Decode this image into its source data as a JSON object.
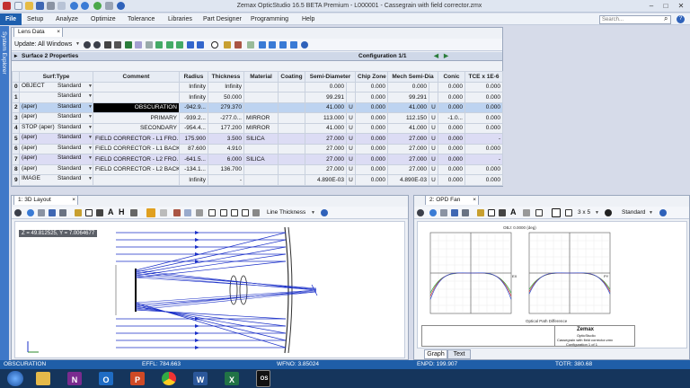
{
  "app": {
    "title": "Zemax OpticStudio 16.5  BETA  Premium - L000001 - Cassegrain with field corrector.zmx",
    "search_placeholder": "Search..."
  },
  "menu": {
    "file": "File",
    "items": [
      "Setup",
      "Analyze",
      "Optimize",
      "Tolerance",
      "Libraries",
      "Part Designer",
      "Programming",
      "Help"
    ]
  },
  "sidebar": {
    "label": "System Explorer"
  },
  "lens_data": {
    "tab": "Lens Data",
    "update_label": "Update: All Windows",
    "props_label": "Surface 2 Properties",
    "config_label": "Configuration 1/1",
    "columns": [
      "Surf:Type",
      "Comment",
      "Radius",
      "Thickness",
      "Material",
      "Coating",
      "Semi-Diameter",
      "Chip Zone",
      "Mech Semi-Dia",
      "Conic",
      "TCE x 1E-6"
    ],
    "rows": [
      {
        "n": "0",
        "name": "OBJECT",
        "type": "Standard",
        "comment": "",
        "radius": "Infinity",
        "thickness": "Infinity",
        "material": "",
        "coating": "",
        "semi": "0.000",
        "su": "",
        "chip": "0.000",
        "mech": "0.000",
        "conic": "0.000",
        "tce": "0.000"
      },
      {
        "n": "1",
        "name": "",
        "type": "Standard",
        "comment": "",
        "radius": "Infinity",
        "thickness": "50.000",
        "material": "",
        "coating": "",
        "semi": "99.291",
        "su": "",
        "chip": "0.000",
        "mech": "99.291",
        "conic": "0.000",
        "tce": "0.000"
      },
      {
        "n": "2",
        "name": "(aper)",
        "type": "Standard",
        "comment": "OBSCURATION",
        "radius": "-942.9...",
        "thickness": "279.370",
        "material": "",
        "coating": "",
        "semi": "41.000",
        "su": "U",
        "chip": "0.000",
        "mech": "41.000",
        "conic": "0.000",
        "tce": "0.000"
      },
      {
        "n": "3",
        "name": "(aper)",
        "type": "Standard",
        "comment": "PRIMARY",
        "radius": "-939.2...",
        "thickness": "-277.0...",
        "material": "MIRROR",
        "coating": "",
        "semi": "113.000",
        "su": "U",
        "chip": "0.000",
        "mech": "112.150",
        "conic": "-1.0...",
        "tce": "0.000"
      },
      {
        "n": "4",
        "name": "STOP (aper)",
        "type": "Standard",
        "comment": "SECONDARY",
        "radius": "-954.4...",
        "thickness": "177.200",
        "material": "MIRROR",
        "coating": "",
        "semi": "41.000",
        "su": "U",
        "chip": "0.000",
        "mech": "41.000",
        "conic": "0.000",
        "tce": "0.000"
      },
      {
        "n": "5",
        "name": "(aper)",
        "type": "Standard",
        "comment": "FIELD CORRECTOR - L1 FRO...",
        "radius": "175.900",
        "thickness": "3.500",
        "material": "SILICA",
        "coating": "",
        "semi": "27.000",
        "su": "U",
        "chip": "0.000",
        "mech": "27.000",
        "conic": "0.000",
        "tce": "-"
      },
      {
        "n": "6",
        "name": "(aper)",
        "type": "Standard",
        "comment": "FIELD CORRECTOR - L1 BACK",
        "radius": "87.600",
        "thickness": "4.910",
        "material": "",
        "coating": "",
        "semi": "27.000",
        "su": "U",
        "chip": "0.000",
        "mech": "27.000",
        "conic": "0.000",
        "tce": "0.000"
      },
      {
        "n": "7",
        "name": "(aper)",
        "type": "Standard",
        "comment": "FIELD CORRECTOR - L2 FRO...",
        "radius": "-641.5...",
        "thickness": "6.000",
        "material": "SILICA",
        "coating": "",
        "semi": "27.000",
        "su": "U",
        "chip": "0.000",
        "mech": "27.000",
        "conic": "0.000",
        "tce": "-"
      },
      {
        "n": "8",
        "name": "(aper)",
        "type": "Standard",
        "comment": "FIELD CORRECTOR - L2 BACK",
        "radius": "-134.1...",
        "thickness": "136.700",
        "material": "",
        "coating": "",
        "semi": "27.000",
        "su": "U",
        "chip": "0.000",
        "mech": "27.000",
        "conic": "0.000",
        "tce": "0.000"
      },
      {
        "n": "9",
        "name": "IMAGE",
        "type": "Standard",
        "comment": "",
        "radius": "Infinity",
        "thickness": "-",
        "material": "",
        "coating": "",
        "semi": "4.890E-03",
        "su": "U",
        "chip": "0.000",
        "mech": "4.890E-03",
        "conic": "0.000",
        "tce": "0.000"
      }
    ]
  },
  "layout3d": {
    "tab": "1: 3D Layout",
    "line_thickness": "Line Thickness",
    "coord": "Z = 49.812525, Y = 7.0064677"
  },
  "opdfan": {
    "tab": "2: OPD Fan",
    "grid": "3 x 5",
    "standard": "Standard",
    "header": "OBJ: 0.0000 (deg)",
    "ex": "EX",
    "py": "PY",
    "footer": "Optical Path Difference",
    "brand": "Zemax",
    "brand_sub": "OpticStudio",
    "info": "Cassegrain with field corrector.zmx",
    "config": "Configuration 1 of 1",
    "bottom_tabs": [
      "Graph",
      "Text"
    ]
  },
  "status": {
    "left": "OBSCURATION",
    "effl": "EFFL: 784.663",
    "wfno": "WFNO: 3.85024",
    "enpd": "ENPD: 199.907",
    "totr": "TOTR: 380.68"
  },
  "colors": {
    "accent": "#1e5fae",
    "ray": "#1a2fc8",
    "curve_green": "#22a83a",
    "curve_red": "#d03030",
    "curve_blue": "#2c4ccf"
  }
}
